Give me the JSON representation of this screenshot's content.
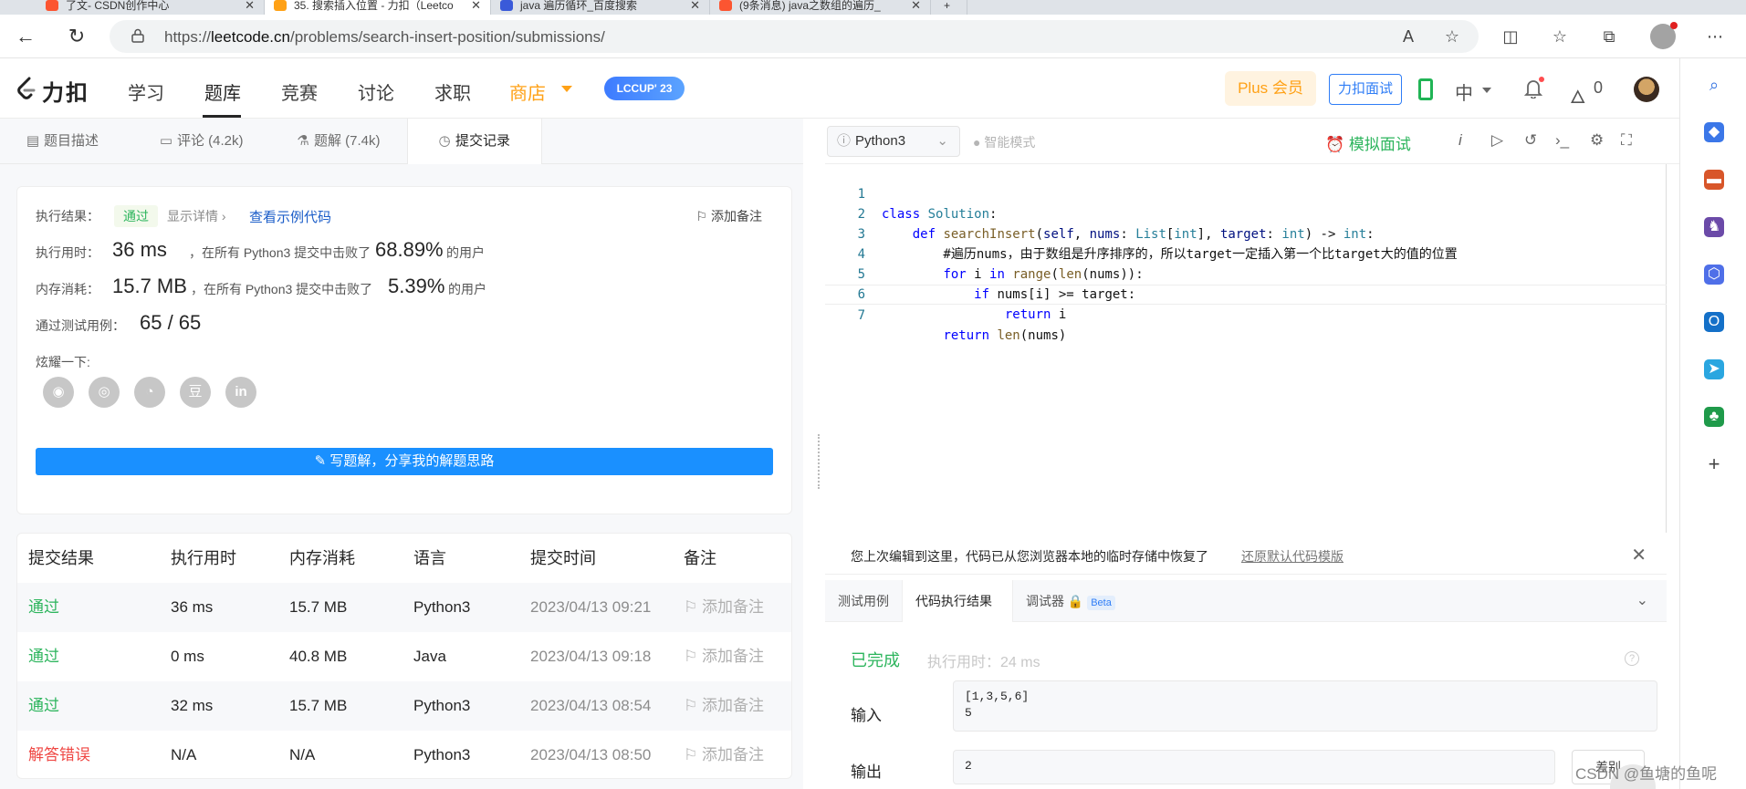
{
  "browser": {
    "tabs": [
      {
        "title": "了文- CSDN创作中心",
        "color": "#fc5531",
        "active": false
      },
      {
        "title": "35. 搜索插入位置 - 力扣（Leetco",
        "color": "#ffa116",
        "active": true
      },
      {
        "title": "java 遍历循环_百度搜索",
        "color": "#3a5ad9",
        "active": false
      },
      {
        "title": "(9条消息) java之数组的遍历_",
        "color": "#fc5531",
        "active": false
      }
    ],
    "url_prefix": "https://",
    "url_host": "leetcode.cn",
    "url_path": "/problems/search-insert-position/submissions/"
  },
  "site": {
    "logo": "力扣",
    "nav": [
      "学习",
      "题库",
      "竞赛",
      "讨论",
      "求职",
      "商店"
    ],
    "badge": "LCCUP' 23",
    "plus": "Plus 会员",
    "interview": "力扣面试",
    "lang": "中",
    "streak": "0"
  },
  "left_tabs": [
    {
      "label": "题目描述",
      "icon": "description-icon"
    },
    {
      "label": "评论 (4.2k)",
      "icon": "comment-icon"
    },
    {
      "label": "题解 (7.4k)",
      "icon": "flask-icon"
    },
    {
      "label": "提交记录",
      "icon": "clock-icon"
    }
  ],
  "result": {
    "label": "执行结果：",
    "status": "通过",
    "details": "显示详情 ›",
    "sample": "查看示例代码",
    "add_note": "添加备注",
    "time_label": "执行用时：",
    "time_value": "36 ms",
    "time_text": "，在所有 Python3 提交中击败了",
    "time_pct": "68.89%",
    "users": "的用户",
    "mem_label": "内存消耗：",
    "mem_value": "15.7 MB",
    "mem_text": "，在所有 Python3 提交中击败了",
    "mem_pct": "5.39%",
    "cases_label": "通过测试用例：",
    "cases_value": "65 / 65",
    "share_label": "炫耀一下:",
    "share_icons": [
      "wechat-icon",
      "weibo-icon",
      "qq-icon",
      "douban-icon",
      "linkedin-icon"
    ],
    "write_solution": "写题解，分享我的解题思路"
  },
  "submissions": {
    "headers": [
      "提交结果",
      "执行用时",
      "内存消耗",
      "语言",
      "提交时间",
      "备注"
    ],
    "rows": [
      {
        "status": "通过",
        "time": "36 ms",
        "memory": "15.7 MB",
        "lang": "Python3",
        "date": "2023/04/13 09:21",
        "note": "添加备注"
      },
      {
        "status": "通过",
        "time": "0 ms",
        "memory": "40.8 MB",
        "lang": "Java",
        "date": "2023/04/13 09:18",
        "note": "添加备注"
      },
      {
        "status": "通过",
        "time": "32 ms",
        "memory": "15.7 MB",
        "lang": "Python3",
        "date": "2023/04/13 08:54",
        "note": "添加备注"
      },
      {
        "status": "解答错误",
        "time": "N/A",
        "memory": "N/A",
        "lang": "Python3",
        "date": "2023/04/13 08:50",
        "note": "添加备注"
      }
    ]
  },
  "editor": {
    "language": "Python3",
    "smart_mode": "智能模式",
    "mock_interview": "模拟面试",
    "code": [
      "class Solution:",
      "    def searchInsert(self, nums: List[int], target: int) -> int:",
      "        #遍历nums，由于数组是升序排序的，所以target一定插入第一个比target大的值的位置",
      "        for i in range(len(nums)):",
      "            if nums[i] >= target:",
      "                return i",
      "        return len(nums)"
    ],
    "line_numbers": [
      "1",
      "2",
      "3",
      "4",
      "5",
      "6",
      "7"
    ]
  },
  "restore": {
    "text": "您上次编辑到这里，代码已从您浏览器本地的临时存储中恢复了",
    "link": "还原默认代码模版"
  },
  "console": {
    "tabs": [
      "测试用例",
      "代码执行结果",
      "调试器"
    ],
    "beta": "Beta",
    "status": "已完成",
    "exec_time": "执行用时：24 ms",
    "input_label": "输入",
    "input_value": "[1,3,5,6]\n5",
    "output_label": "输出",
    "output_value": "2",
    "diff": "差别"
  },
  "watermark": "CSDN @鱼塘的鱼呢"
}
